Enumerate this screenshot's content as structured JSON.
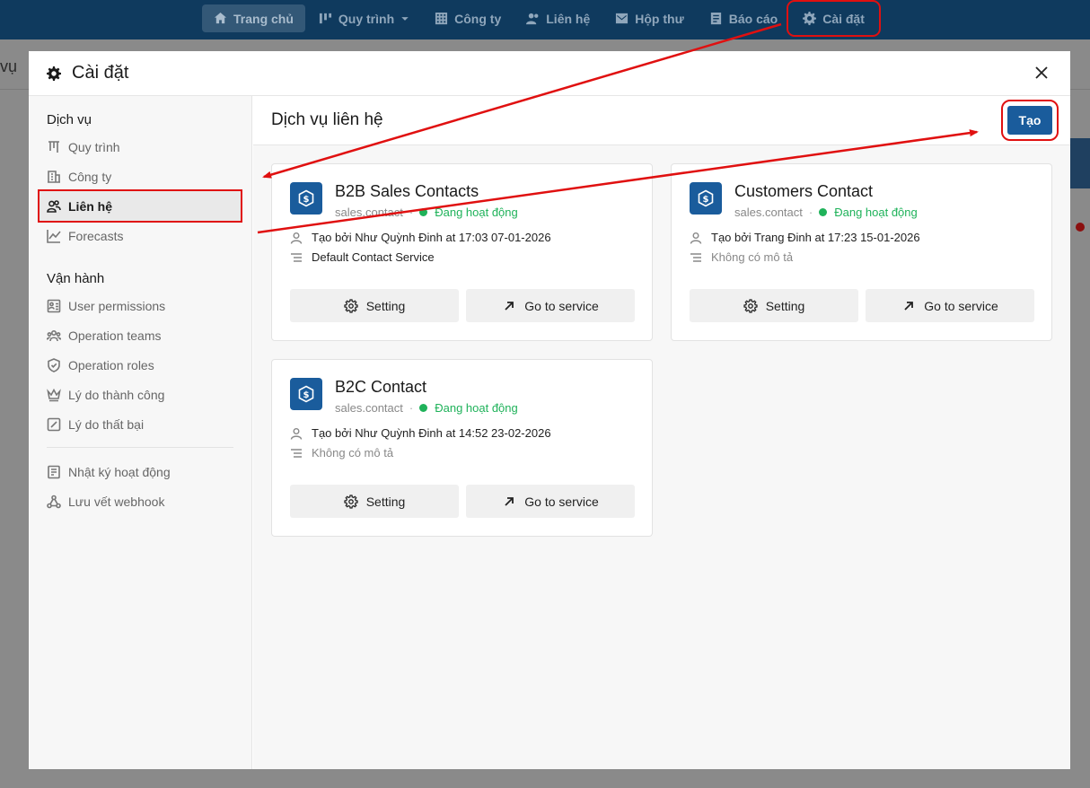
{
  "topnav": {
    "items": [
      {
        "label": "Trang chủ",
        "icon": "home-icon"
      },
      {
        "label": "Quy trình",
        "icon": "pipeline-icon"
      },
      {
        "label": "Công ty",
        "icon": "building-icon"
      },
      {
        "label": "Liên hệ",
        "icon": "contacts-icon"
      },
      {
        "label": "Hộp thư",
        "icon": "mail-icon"
      },
      {
        "label": "Báo cáo",
        "icon": "report-icon"
      },
      {
        "label": "Cài đặt",
        "icon": "gear-icon"
      }
    ]
  },
  "background": {
    "title_fragment": "vụ"
  },
  "modal": {
    "title": "Cài đặt",
    "close_icon": "close-icon",
    "sidebar": {
      "section_service": "Dịch vụ",
      "service_items": [
        {
          "label": "Quy trình",
          "icon": "pipeline-icon"
        },
        {
          "label": "Công ty",
          "icon": "building-icon"
        },
        {
          "label": "Liên hệ",
          "icon": "contacts-icon"
        },
        {
          "label": "Forecasts",
          "icon": "chart-line-icon"
        }
      ],
      "section_ops": "Vận hành",
      "ops_items": [
        {
          "label": "User permissions",
          "icon": "user-list-icon"
        },
        {
          "label": "Operation teams",
          "icon": "team-icon"
        },
        {
          "label": "Operation roles",
          "icon": "shield-icon"
        },
        {
          "label": "Lý do thành công",
          "icon": "crown-icon"
        },
        {
          "label": "Lý do thất bại",
          "icon": "slash-box-icon"
        }
      ],
      "extra_items": [
        {
          "label": "Nhật ký hoạt động",
          "icon": "log-icon"
        },
        {
          "label": "Lưu vết webhook",
          "icon": "webhook-icon"
        }
      ]
    },
    "content": {
      "title": "Dịch vụ liên hệ",
      "create_label": "Tạo",
      "cards": [
        {
          "name": "B2B Sales Contacts",
          "domain": "sales.contact",
          "status": "Đang hoạt động",
          "created": "Tạo bởi Như Quỳnh Đinh at 17:03 07-01-2026",
          "description": "Default Contact Service",
          "setting_label": "Setting",
          "goto_label": "Go to service"
        },
        {
          "name": "Customers Contact",
          "domain": "sales.contact",
          "status": "Đang hoạt động",
          "created": "Tạo bởi Trang Đinh at 17:23 15-01-2026",
          "description": "Không có mô tả",
          "setting_label": "Setting",
          "goto_label": "Go to service"
        },
        {
          "name": "B2C Contact",
          "domain": "sales.contact",
          "status": "Đang hoạt động",
          "created": "Tạo bởi Như Quỳnh Đinh at 14:52 23-02-2026",
          "description": "Không có mô tả",
          "setting_label": "Setting",
          "goto_label": "Go to service"
        }
      ]
    }
  },
  "colors": {
    "nav_bg": "#0f3a5e",
    "primary": "#1a5c9c",
    "status_green": "#1fb25a",
    "annotation_red": "#e01010"
  }
}
